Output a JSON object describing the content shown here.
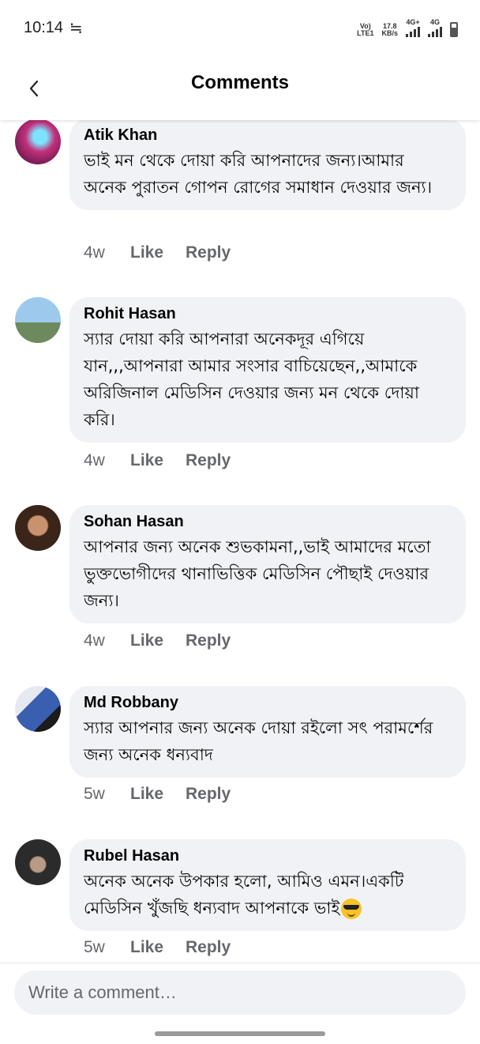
{
  "status_bar": {
    "time": "10:14",
    "glyph": "≒",
    "volte_top": "Vo)",
    "volte_bottom": "LTE1",
    "speed_value": "17.8",
    "speed_unit": "KB/s",
    "net1": "4G+",
    "net2": "4G"
  },
  "header": {
    "title": "Comments",
    "back_icon": "chevron-left-icon"
  },
  "comments": [
    {
      "author": "Atik Khan",
      "text": "ভাই মন থেকে দোয়া করি আপনাদের জন্য।আমার অনেক পুরাতন গোপন রোগের সমাধান দেওয়ার জন্য।",
      "time": "4w",
      "like": "Like",
      "reply": "Reply",
      "avatar_color": "#c2307a"
    },
    {
      "author": "Rohit Hasan",
      "text": "স্যার দোয়া করি আপনারা অনেকদূর এগিয়ে যান,,,আপনারা আমার সংসার বাচিয়েছেন,,আমাকে অরিজিনাল মেডিসিন দেওয়ার জন্য মন থেকে দোয়া করি।",
      "time": "4w",
      "like": "Like",
      "reply": "Reply",
      "avatar_color": "#7fb1d8"
    },
    {
      "author": "Sohan Hasan",
      "text": "আপনার জন্য অনেক শুভকামনা,,ভাই আমাদের মতো ভুক্তভোগীদের থানাভিত্তিক মেডিসিন পৌছাই দেওয়ার জন্য।",
      "time": "4w",
      "like": "Like",
      "reply": "Reply",
      "avatar_color": "#6b4a3a"
    },
    {
      "author": "Md Robbany",
      "text": "স্যার আপনার জন্য অনেক দোয়া রইলো সৎ পরামর্শের জন্য অনেক ধন্যবাদ",
      "time": "5w",
      "like": "Like",
      "reply": "Reply",
      "avatar_color": "#3a5fb0"
    },
    {
      "author": "Rubel Hasan",
      "text": "অনেক অনেক উপকার হলো, আমিও এমন।একটি মেডিসিন খুঁজছি ধন্যবাদ আপনাকে ভাই",
      "time": "5w",
      "like": "Like",
      "reply": "Reply",
      "avatar_color": "#3b3b3b",
      "emoji": "smiling-face-with-sunglasses"
    }
  ],
  "composer": {
    "placeholder": "Write a comment…"
  }
}
